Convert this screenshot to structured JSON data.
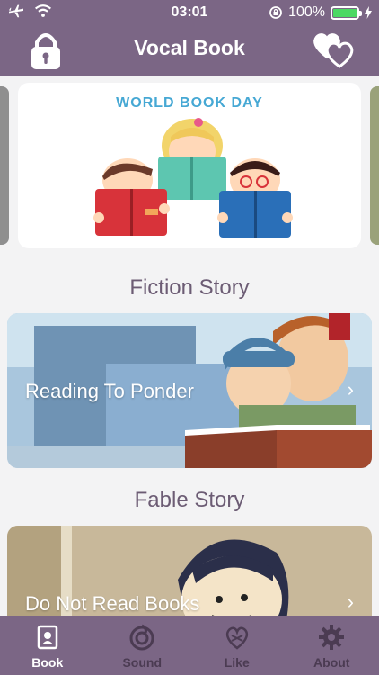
{
  "status_bar": {
    "time": "03:01",
    "battery": "100%"
  },
  "nav": {
    "title": "Vocal Book",
    "left_icon": "lock-icon",
    "right_icon": "hearts-icon"
  },
  "banner": {
    "heading": "WORLD BOOK DAY"
  },
  "sections": [
    {
      "title": "Fiction Story",
      "card_label": "Reading To Ponder"
    },
    {
      "title": "Fable Story",
      "card_label": "Do Not Read Books"
    }
  ],
  "tabs": [
    {
      "label": "Book",
      "icon": "book-icon",
      "active": true
    },
    {
      "label": "Sound",
      "icon": "sound-icon",
      "active": false
    },
    {
      "label": "Like",
      "icon": "like-icon",
      "active": false
    },
    {
      "label": "About",
      "icon": "gear-icon",
      "active": false
    }
  ],
  "colors": {
    "primary": "#7b6685",
    "background": "#f3f3f4",
    "section_title": "#6c5c74"
  }
}
